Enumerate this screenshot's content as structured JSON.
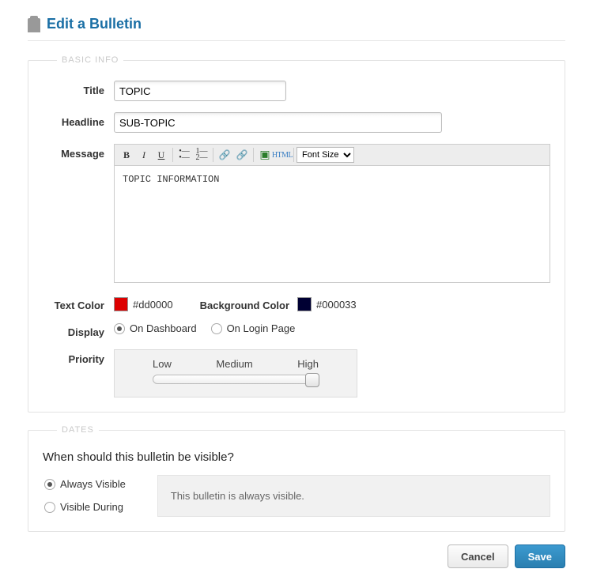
{
  "header": {
    "title": "Edit a Bulletin"
  },
  "basic_info": {
    "legend": "BASIC INFO",
    "title_label": "Title",
    "title_value": "TOPIC",
    "headline_label": "Headline",
    "headline_value": "SUB-TOPIC",
    "message_label": "Message",
    "message_value": "TOPIC INFORMATION",
    "font_size_label": "Font Size",
    "text_color_label": "Text Color",
    "text_color_value": "#dd0000",
    "bg_color_label": "Background Color",
    "bg_color_value": "#000033",
    "display_label": "Display",
    "display_opts": {
      "dashboard": "On Dashboard",
      "login": "On Login Page",
      "selected": "dashboard"
    },
    "priority": {
      "label": "Priority",
      "low": "Low",
      "medium": "Medium",
      "high": "High"
    }
  },
  "dates": {
    "legend": "DATES",
    "question": "When should this bulletin be visible?",
    "opts": {
      "always": "Always Visible",
      "during": "Visible During",
      "selected": "always"
    },
    "info_text": "This bulletin is always visible."
  },
  "buttons": {
    "cancel": "Cancel",
    "save": "Save"
  }
}
